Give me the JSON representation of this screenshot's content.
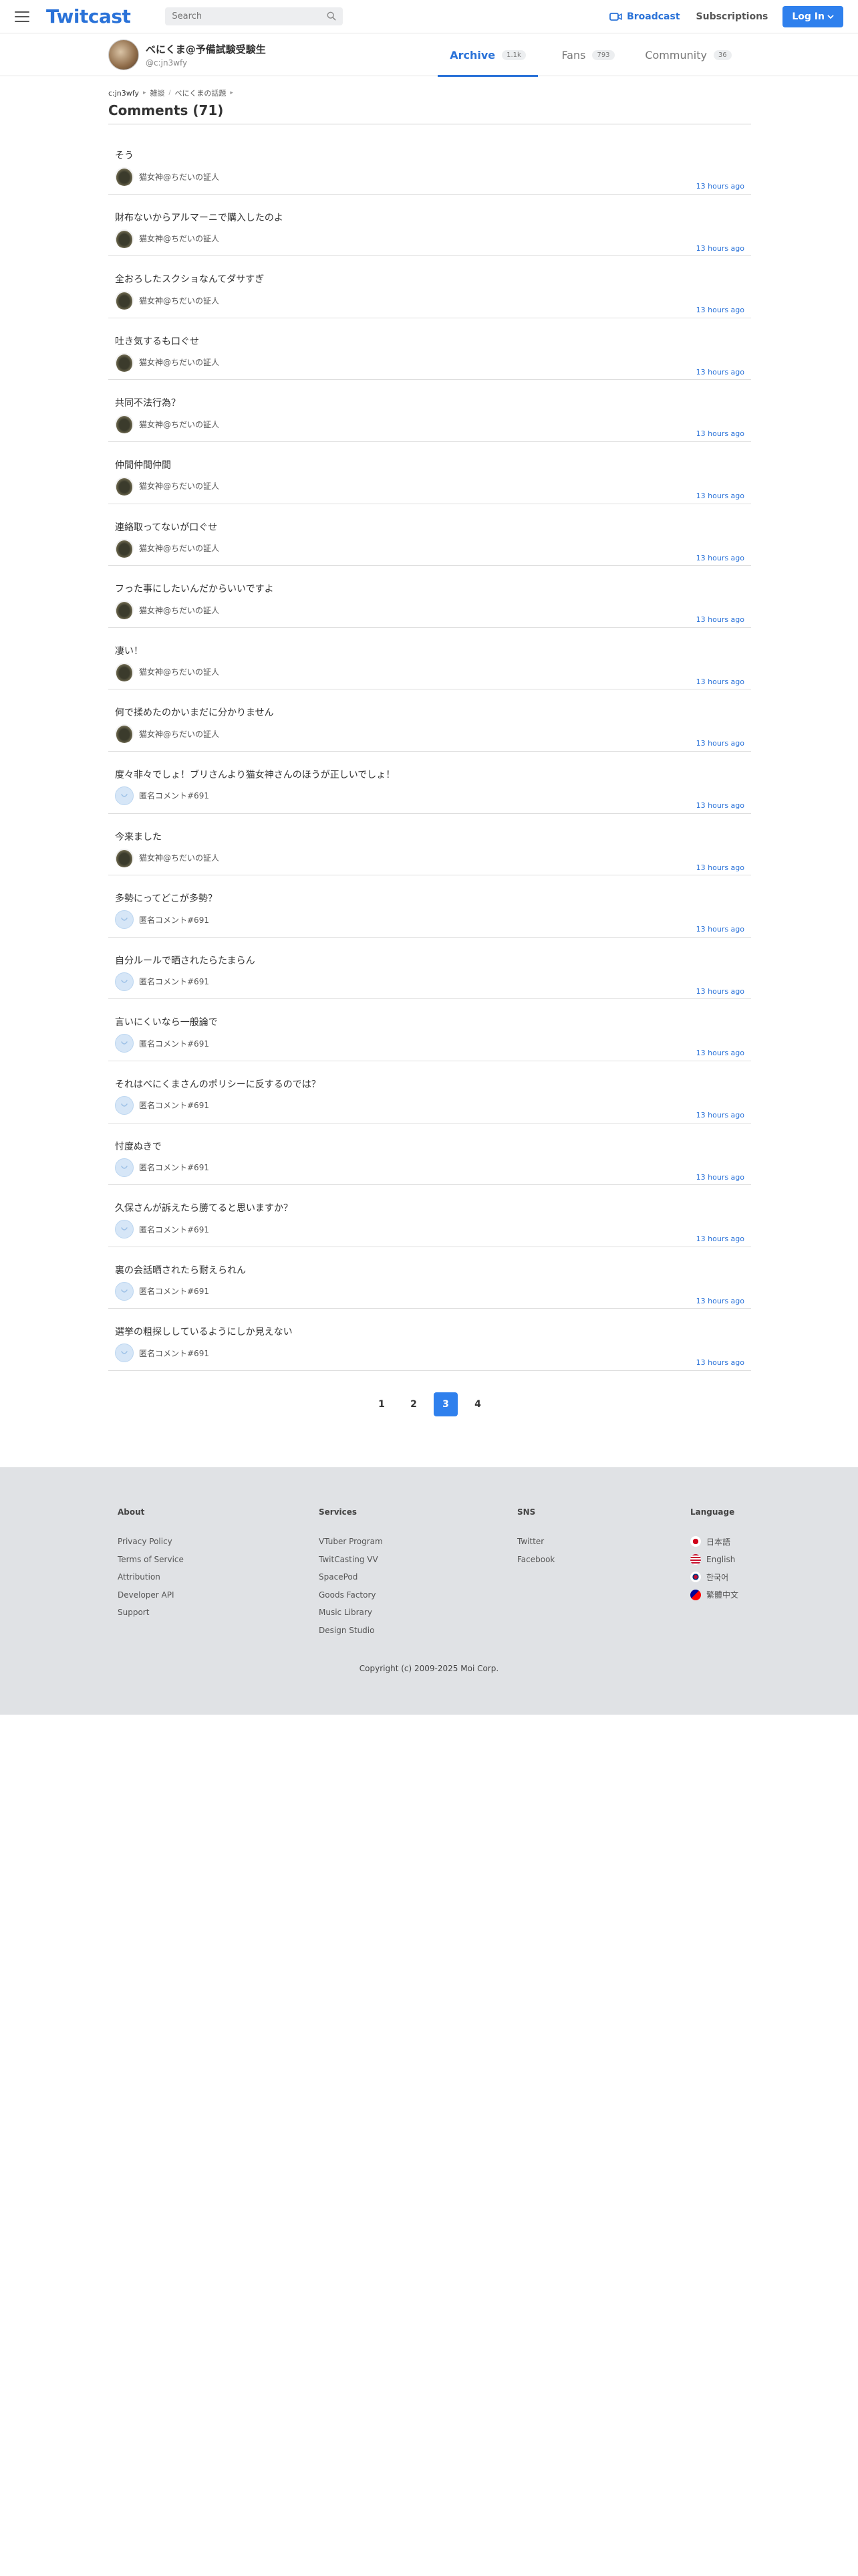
{
  "header": {
    "logo": "Twitcast",
    "search_placeholder": "Search",
    "broadcast_label": "Broadcast",
    "subscriptions_label": "Subscriptions",
    "login_label": "Log In"
  },
  "profile": {
    "name": "べにくま@予備試験受験生",
    "id": "@c:jn3wfy",
    "tabs": [
      {
        "label": "Archive",
        "count": "1.1k"
      },
      {
        "label": "Fans",
        "count": "793"
      },
      {
        "label": "Community",
        "count": "36"
      }
    ]
  },
  "breadcrumb": [
    "c:jn3wfy",
    "雑談",
    "べにくまの話題"
  ],
  "page_title": "Comments (71)",
  "comments": [
    {
      "text": "そう",
      "user": "猫女神@ちだいの証人",
      "avatar": "cat",
      "time": "13 hours ago"
    },
    {
      "text": "財布ないからアルマーニで購入したのよ",
      "user": "猫女神@ちだいの証人",
      "avatar": "cat",
      "time": "13 hours ago"
    },
    {
      "text": "全おろしたスクショなんてダサすぎ",
      "user": "猫女神@ちだいの証人",
      "avatar": "cat",
      "time": "13 hours ago"
    },
    {
      "text": "吐き気するも口ぐせ",
      "user": "猫女神@ちだいの証人",
      "avatar": "cat",
      "time": "13 hours ago"
    },
    {
      "text": "共同不法行為？",
      "user": "猫女神@ちだいの証人",
      "avatar": "cat",
      "time": "13 hours ago"
    },
    {
      "text": "仲間仲間仲間",
      "user": "猫女神@ちだいの証人",
      "avatar": "cat",
      "time": "13 hours ago"
    },
    {
      "text": "連絡取ってないが口ぐせ",
      "user": "猫女神@ちだいの証人",
      "avatar": "cat",
      "time": "13 hours ago"
    },
    {
      "text": "フった事にしたいんだからいいですよ",
      "user": "猫女神@ちだいの証人",
      "avatar": "cat",
      "time": "13 hours ago"
    },
    {
      "text": "凄い！",
      "user": "猫女神@ちだいの証人",
      "avatar": "cat",
      "time": "13 hours ago"
    },
    {
      "text": "何で揉めたのかいまだに分かりません",
      "user": "猫女神@ちだいの証人",
      "avatar": "cat",
      "time": "13 hours ago"
    },
    {
      "text": "度々非々でしょ！ブリさんより猫女神さんのほうが正しいでしょ！",
      "user": "匿名コメント#691",
      "avatar": "anon",
      "time": "13 hours ago"
    },
    {
      "text": "今来ました",
      "user": "猫女神@ちだいの証人",
      "avatar": "cat",
      "time": "13 hours ago"
    },
    {
      "text": "多勢にってどこが多勢？",
      "user": "匿名コメント#691",
      "avatar": "anon",
      "time": "13 hours ago"
    },
    {
      "text": "自分ルールで晒されたらたまらん",
      "user": "匿名コメント#691",
      "avatar": "anon",
      "time": "13 hours ago"
    },
    {
      "text": "言いにくいなら一般論で",
      "user": "匿名コメント#691",
      "avatar": "anon",
      "time": "13 hours ago"
    },
    {
      "text": "それはべにくまさんのポリシーに反するのでは？",
      "user": "匿名コメント#691",
      "avatar": "anon",
      "time": "13 hours ago"
    },
    {
      "text": "忖度ぬきで",
      "user": "匿名コメント#691",
      "avatar": "anon",
      "time": "13 hours ago"
    },
    {
      "text": "久保さんが訴えたら勝てると思いますか？",
      "user": "匿名コメント#691",
      "avatar": "anon",
      "time": "13 hours ago"
    },
    {
      "text": "裏の会話晒されたら耐えられん",
      "user": "匿名コメント#691",
      "avatar": "anon",
      "time": "13 hours ago"
    },
    {
      "text": "選挙の粗探ししているようにしか見えない",
      "user": "匿名コメント#691",
      "avatar": "anon",
      "time": "13 hours ago"
    }
  ],
  "pagination": {
    "pages": [
      "1",
      "2",
      "3",
      "4"
    ],
    "current": "3"
  },
  "footer": {
    "about": {
      "heading": "About",
      "links": [
        "Privacy Policy",
        "Terms of Service",
        "Attribution",
        "Developer API",
        "Support"
      ]
    },
    "services": {
      "heading": "Services",
      "links": [
        "VTuber Program",
        "TwitCasting VV",
        "SpacePod",
        "Goods Factory",
        "Music Library",
        "Design Studio"
      ]
    },
    "sns": {
      "heading": "SNS",
      "links": [
        "Twitter",
        "Facebook"
      ]
    },
    "language": {
      "heading": "Language",
      "links": [
        "日本語",
        "English",
        "한국어",
        "繁體中文"
      ]
    },
    "copyright": "Copyright (c) 2009-2025 Moi Corp."
  },
  "colors": {
    "accent": "#2a72d8",
    "button": "#2f80ed",
    "footer_bg": "#e0e2e5"
  }
}
